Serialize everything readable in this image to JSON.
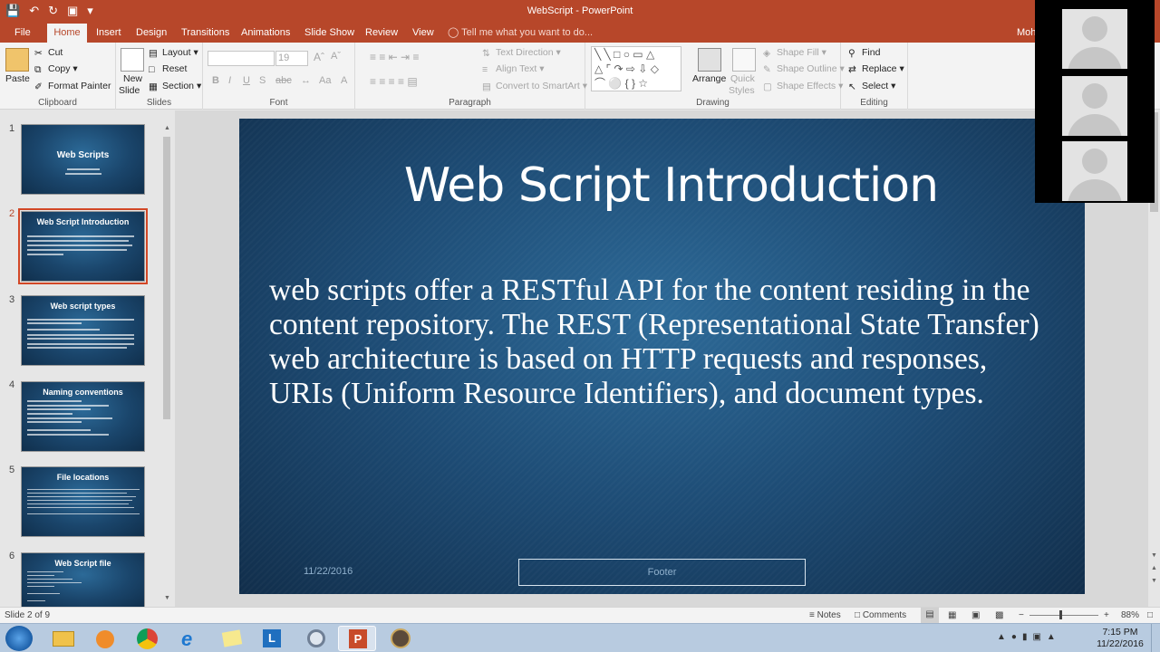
{
  "window": {
    "title": "WebScript - PowerPoint",
    "user": "Moh"
  },
  "ribbon_tabs": [
    "File",
    "Home",
    "Insert",
    "Design",
    "Transitions",
    "Animations",
    "Slide Show",
    "Review",
    "View"
  ],
  "active_tab": "Home",
  "tell_me": "Tell me what you want to do...",
  "ribbon": {
    "clipboard": {
      "paste": "Paste",
      "cut": "Cut",
      "copy": "Copy",
      "format_painter": "Format Painter",
      "label": "Clipboard"
    },
    "slides": {
      "new_slide_1": "New",
      "new_slide_2": "Slide",
      "layout": "Layout",
      "reset": "Reset",
      "section": "Section",
      "label": "Slides"
    },
    "font": {
      "font_name": "",
      "font_size": "19",
      "label": "Font"
    },
    "paragraph": {
      "text_direction": "Text Direction",
      "align_text": "Align Text",
      "convert_smartart": "Convert to SmartArt",
      "label": "Paragraph"
    },
    "drawing": {
      "arrange": "Arrange",
      "quick_styles_1": "Quick",
      "quick_styles_2": "Styles",
      "shape_fill": "Shape Fill",
      "shape_outline": "Shape Outline",
      "shape_effects": "Shape Effects",
      "label": "Drawing"
    },
    "editing": {
      "find": "Find",
      "replace": "Replace",
      "select": "Select",
      "label": "Editing"
    }
  },
  "thumbnails": [
    {
      "num": "1",
      "title": "Web Scripts"
    },
    {
      "num": "2",
      "title": "Web Script Introduction"
    },
    {
      "num": "3",
      "title": "Web script types"
    },
    {
      "num": "4",
      "title": "Naming conventions"
    },
    {
      "num": "5",
      "title": "File locations"
    },
    {
      "num": "6",
      "title": "Web Script file"
    }
  ],
  "slide": {
    "title": "Web Script Introduction",
    "body": "web scripts offer a RESTful API for the content residing in the content repository. The REST (Representational State Transfer) web architecture is based on HTTP requests and responses, URIs (Uniform Resource Identifiers), and document types.",
    "date": "11/22/2016",
    "footer": "Footer"
  },
  "statusbar": {
    "slide_info": "Slide 2 of 9",
    "notes": "Notes",
    "comments": "Comments",
    "zoom": "88%"
  },
  "taskbar": {
    "time": "7:15 PM",
    "date": "11/22/2016"
  },
  "colors": {
    "accent": "#b7472a",
    "slide_bg": "#1d4b74"
  }
}
